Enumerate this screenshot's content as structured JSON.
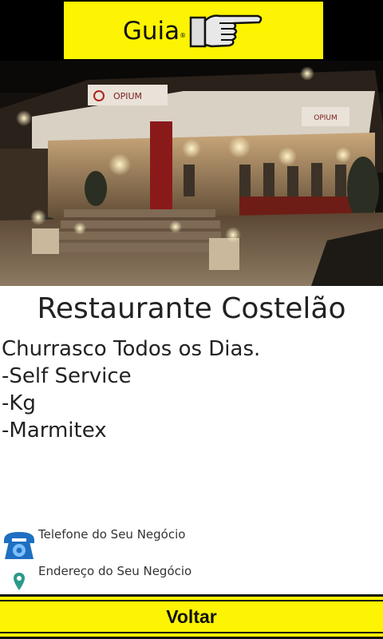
{
  "header": {
    "logo_text": "Guia",
    "logo_mark": "®",
    "logo_icon": "pointing-hand-icon",
    "background_color": "#000000",
    "logo_color": "#fcf402"
  },
  "photo": {
    "sign_left": "OPIUM",
    "sign_right": "OPIUM"
  },
  "business": {
    "name": "Restaurante Costelão",
    "description": [
      "Churrasco Todos os Dias.",
      "-Self Service",
      "-Kg",
      "-Marmitex"
    ]
  },
  "contacts": {
    "phone_label": "Telefone do Seu Negócio",
    "phone_icon": "telephone-icon",
    "address_label": "Endereço do Seu Negócio",
    "address_icon": "map-pin-icon"
  },
  "footer": {
    "back_label": "Voltar"
  }
}
